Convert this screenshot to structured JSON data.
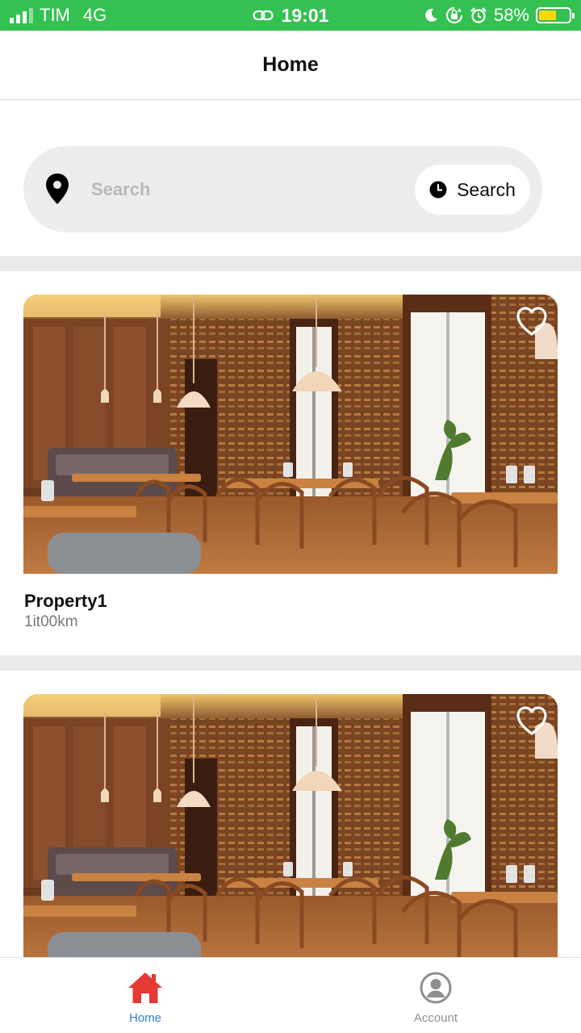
{
  "status_bar": {
    "carrier": "TIM",
    "network": "4G",
    "time": "19:01",
    "battery_percent": "58%",
    "battery_level": 0.58,
    "icons": [
      "signal-icon",
      "link-icon",
      "moon-icon",
      "rotation-lock-icon",
      "alarm-icon",
      "battery-icon"
    ]
  },
  "header": {
    "title": "Home"
  },
  "search": {
    "placeholder": "Search",
    "value": "",
    "button_label": "Search",
    "left_icon": "location-pin-icon",
    "button_icon": "clock-icon"
  },
  "properties": [
    {
      "name": "Property1",
      "distance": "1it00km",
      "favorite_icon": "heart-outline-icon"
    },
    {
      "name": "",
      "distance": "",
      "favorite_icon": "heart-outline-icon"
    }
  ],
  "tab_bar": {
    "tabs": [
      {
        "label": "Home",
        "icon": "home-icon",
        "active": true
      },
      {
        "label": "Account",
        "icon": "account-icon",
        "active": false
      }
    ]
  },
  "colors": {
    "status_bar": "#35c152",
    "active_tab_icon": "#e53935",
    "active_tab_label": "#2f7fd6",
    "inactive_tab": "#8f8f8f",
    "search_background": "#ededed"
  }
}
